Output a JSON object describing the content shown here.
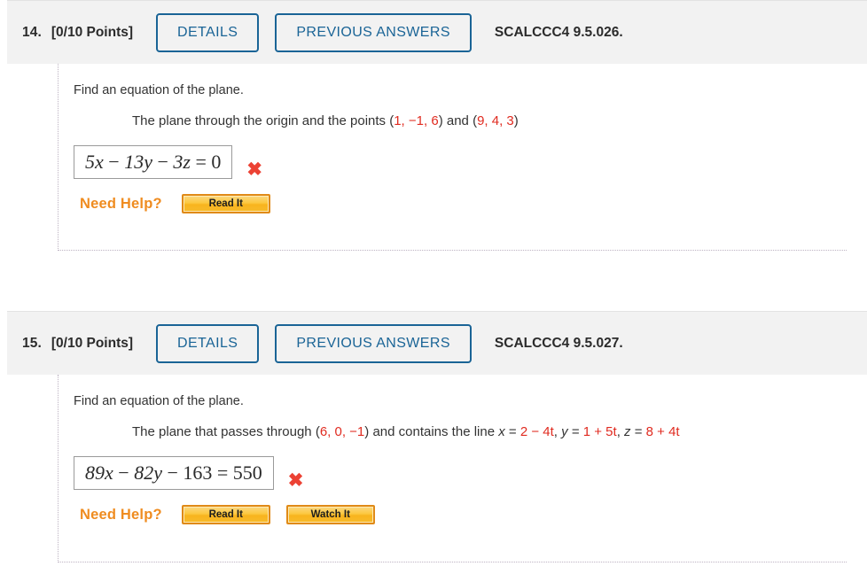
{
  "problems": [
    {
      "number": "14.",
      "points": "[0/10 Points]",
      "details_label": "DETAILS",
      "previous_answers_label": "PREVIOUS ANSWERS",
      "reference": "SCALCCC4 9.5.026.",
      "prompt": "Find an equation of the plane.",
      "statement": {
        "lead": "The plane through the origin and the points",
        "point1_open": "(",
        "point1": "1, −1, 6",
        "point1_close": ")",
        "conjunction": "and",
        "point2_open": "(",
        "point2": "9, 4, 3",
        "point2_close": ")"
      },
      "answer": {
        "value": "5x − 13y − 3z = 0",
        "coef_x": "5x",
        "op1": "−",
        "coef_y": "13y",
        "op2": "−",
        "coef_z": "3z",
        "equals": "=",
        "rhs": "0",
        "status_icon": "wrong-answer-x",
        "status_mark": "✖"
      },
      "help_label": "Need Help?",
      "help_buttons": [
        "Read It"
      ]
    },
    {
      "number": "15.",
      "points": "[0/10 Points]",
      "details_label": "DETAILS",
      "previous_answers_label": "PREVIOUS ANSWERS",
      "reference": "SCALCCC4 9.5.027.",
      "prompt": "Find an equation of the plane.",
      "statement": {
        "lead": "The plane that passes through",
        "point1_open": "(",
        "point1": "6, 0, −1",
        "point1_close": ")",
        "conjunction": "and contains the line",
        "line": {
          "x_var": "x",
          "x_eq": "=",
          "x_val": "2 − 4t",
          "sep1": ",",
          "y_var": "y",
          "y_eq": "=",
          "y_val": "1 + 5t",
          "sep2": ",",
          "z_var": "z",
          "z_eq": "=",
          "z_val": "8 + 4t"
        }
      },
      "answer": {
        "value": "89x − 82y − 163 = 550",
        "coef_x": "89x",
        "op1": "−",
        "coef_y": "82y",
        "op2": "−",
        "coef_z": "163",
        "equals": "=",
        "rhs": "550",
        "status_icon": "wrong-answer-x",
        "status_mark": "✖"
      },
      "help_label": "Need Help?",
      "help_buttons": [
        "Read It",
        "Watch It"
      ]
    }
  ],
  "colors": {
    "link_blue": "#1a6496",
    "error_red": "#e02b20",
    "help_orange": "#ef8c20",
    "header_bg": "#f2f2f2"
  }
}
